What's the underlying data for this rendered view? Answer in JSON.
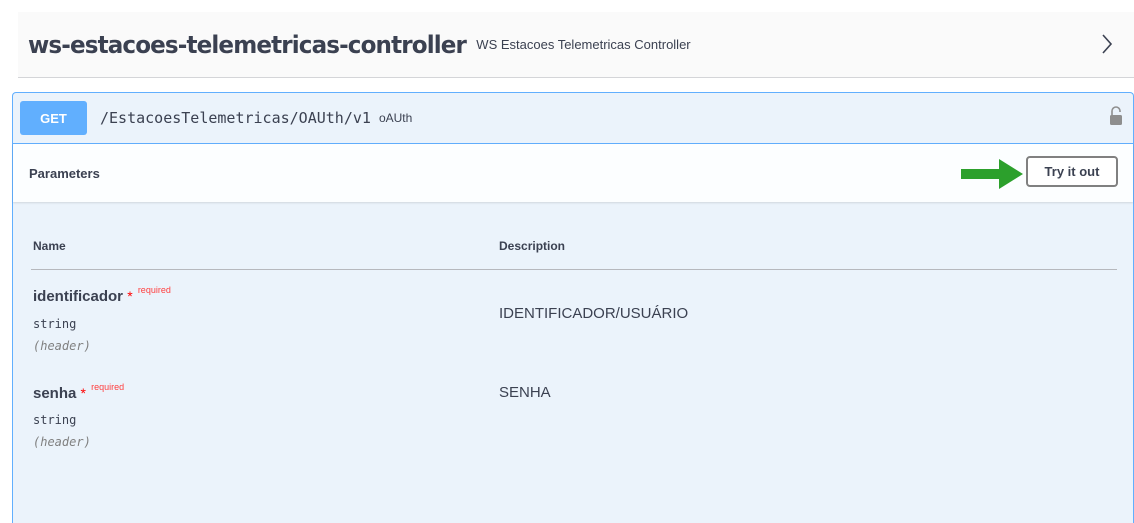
{
  "tag": {
    "name": "ws-estacoes-telemetricas-controller",
    "description": "WS Estacoes Telemetricas Controller",
    "chevron_icon": "chevron-right-icon"
  },
  "operation": {
    "method": "GET",
    "path": "/EstacoesTelemetricas/OAUth/v1",
    "summary": "oAUth",
    "lock_icon": "unlocked-padlock-icon",
    "method_color": "#61affe"
  },
  "parameters": {
    "title": "Parameters",
    "try_label": "Try it out",
    "arrow_icon": "green-arrow-right-icon",
    "arrow_color": "#2ca02c",
    "columns": {
      "name": "Name",
      "description": "Description"
    },
    "items": [
      {
        "name": "identificador",
        "required_mark": "*",
        "required_label": "required",
        "type": "string",
        "in": "(header)",
        "description": "IDENTIFICADOR/USUÁRIO"
      },
      {
        "name": "senha",
        "required_mark": "*",
        "required_label": "required",
        "type": "string",
        "in": "(header)",
        "description": "SENHA"
      }
    ]
  }
}
